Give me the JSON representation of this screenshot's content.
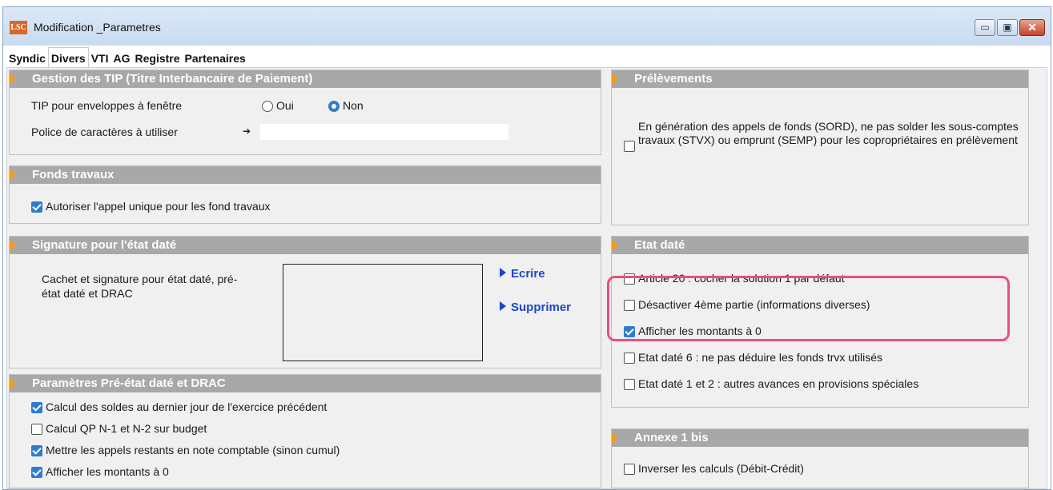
{
  "window": {
    "title": "Modification _Parametres",
    "logo_text": "LSC",
    "minimize_glyph": "▭",
    "maximize_glyph": "▣",
    "close_glyph": "✕"
  },
  "tabs": [
    {
      "label": "Syndic",
      "active": false
    },
    {
      "label": "Divers",
      "active": true
    },
    {
      "label": "VTI",
      "active": false
    },
    {
      "label": "AG",
      "active": false
    },
    {
      "label": "Registre",
      "active": false
    },
    {
      "label": "Partenaires",
      "active": false
    }
  ],
  "tip": {
    "header": "Gestion des TIP (Titre Interbancaire de Paiement)",
    "enveloppe_label": "TIP pour enveloppes à fenêtre",
    "oui_label": "Oui",
    "non_label": "Non",
    "selected": "Non",
    "police_label": "Police de caractères à utiliser",
    "police_arrow": "➔",
    "police_value": ""
  },
  "fonds_travaux": {
    "header": "Fonds travaux",
    "appel_unique_label": "Autoriser l'appel unique pour les fond travaux",
    "appel_unique_checked": true
  },
  "signature": {
    "header": "Signature pour l'état daté",
    "description": "Cachet et signature pour état daté, pré-état daté et DRAC",
    "ecrire_label": "Ecrire",
    "supprimer_label": "Supprimer"
  },
  "pre_etat": {
    "header": "Paramètres Pré-état daté et DRAC",
    "items": [
      {
        "label": "Calcul des soldes au dernier jour de l'exercice précédent",
        "checked": true
      },
      {
        "label": "Calcul QP N-1 et N-2 sur budget",
        "checked": false
      },
      {
        "label": "Mettre les appels restants en note comptable (sinon cumul)",
        "checked": true
      },
      {
        "label": "Afficher les montants à 0",
        "checked": true
      }
    ]
  },
  "prelevements": {
    "header": "Prélèvements",
    "text": "En génération des appels de fonds (SORD), ne pas solder les sous-comptes travaux (STVX) ou emprunt (SEMP) pour les copropriétaires en prélèvement",
    "checked": false
  },
  "etat_date": {
    "header": "Etat daté",
    "items": [
      {
        "label": "Article 20 : cocher la solution 1 par défaut",
        "checked": false
      },
      {
        "label": "Désactiver 4ème partie (informations diverses)",
        "checked": false
      },
      {
        "label": "Afficher les montants à 0",
        "checked": true
      },
      {
        "label": "Etat daté 6 : ne pas déduire les fonds trvx utilisés",
        "checked": false
      },
      {
        "label": "Etat daté 1 et 2 : autres avances en provisions spéciales",
        "checked": false
      }
    ]
  },
  "annexe": {
    "header": "Annexe 1 bis",
    "inverser_label": "Inverser les calculs (Débit-Crédit)",
    "inverser_checked": false
  },
  "colors": {
    "header_bg": "#a8a8a8",
    "header_arrow": "#f29c1f",
    "checkbox_on": "#2f7ccf",
    "link": "#1e45c8",
    "highlight": "#e8507a"
  }
}
